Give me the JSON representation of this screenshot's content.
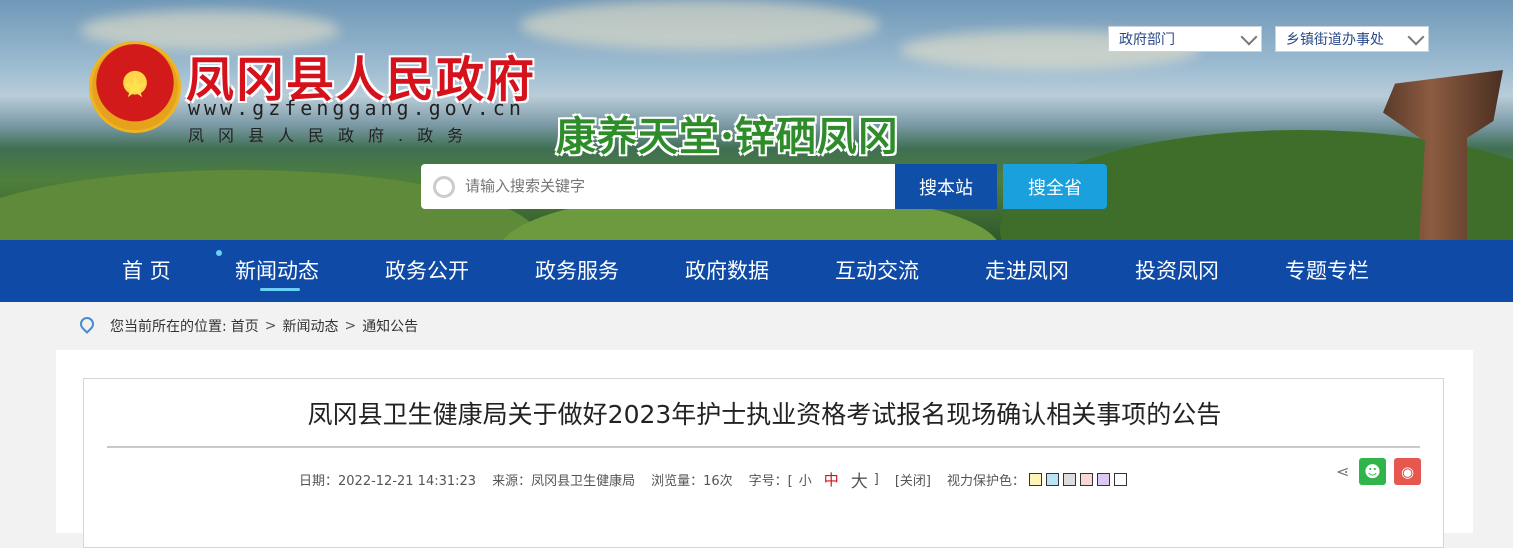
{
  "header": {
    "site_title": "凤冈县人民政府",
    "site_url": "www.gzfenggang.gov.cn",
    "site_sub": "凤冈县人民政府.政务",
    "slogan": "康养天堂·锌硒凤冈",
    "dropdowns": [
      {
        "label": "政府部门"
      },
      {
        "label": "乡镇街道办事处"
      }
    ],
    "search": {
      "placeholder": "请输入搜索关键字",
      "btn_site": "搜本站",
      "btn_province": "搜全省"
    }
  },
  "nav": {
    "items": [
      {
        "label": "首 页"
      },
      {
        "label": "新闻动态"
      },
      {
        "label": "政务公开"
      },
      {
        "label": "政务服务"
      },
      {
        "label": "政府数据"
      },
      {
        "label": "互动交流"
      },
      {
        "label": "走进凤冈"
      },
      {
        "label": "投资凤冈"
      },
      {
        "label": "专题专栏"
      }
    ],
    "active": "新闻动态"
  },
  "breadcrumb": {
    "prefix": "您当前所在的位置:",
    "items": [
      "首页",
      "新闻动态",
      "通知公告"
    ],
    "separator": ">"
  },
  "article": {
    "title": "凤冈县卫生健康局关于做好2023年护士执业资格考试报名现场确认相关事项的公告",
    "date": "日期：2022-12-21 14:31:23",
    "source": "来源：凤冈县卫生健康局",
    "views": "浏览量：16次",
    "font_label": "字号：[",
    "font_small": "小",
    "font_mid": "中",
    "font_big": "大",
    "font_close": "]",
    "close": "[关闭]",
    "eye_care": "视力保护色：",
    "swatch_colors": [
      "#fdf5b4",
      "#b9e4f7",
      "#dcdcdc",
      "#f8d6da",
      "#dcc8f3",
      "#ffffff"
    ]
  }
}
